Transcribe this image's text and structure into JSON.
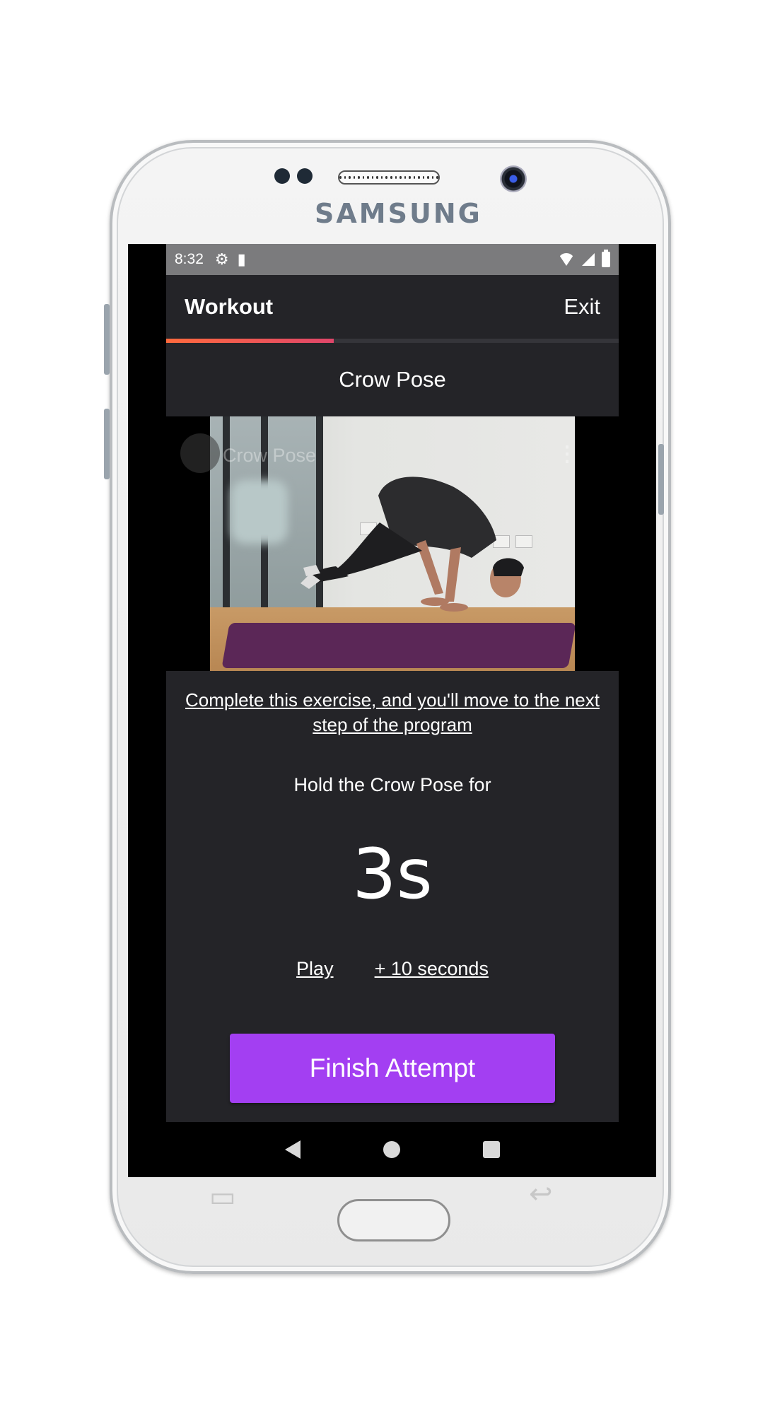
{
  "device": {
    "brand": "SAMSUNG"
  },
  "status_bar": {
    "time": "8:32",
    "icons_left": [
      "gear-icon",
      "sd-card-icon"
    ],
    "icons_right": [
      "wifi-icon",
      "signal-icon",
      "battery-icon"
    ]
  },
  "app_bar": {
    "title": "Workout",
    "exit_label": "Exit"
  },
  "progress": {
    "fraction": 0.37,
    "gradient": [
      "#ff6a3d",
      "#e0466a"
    ]
  },
  "exercise": {
    "name": "Crow Pose"
  },
  "video": {
    "overlay_title": "Crow Pose"
  },
  "main": {
    "hint": "Complete this exercise, and you'll move to the next step of the program",
    "hold_label": "Hold the Crow Pose for",
    "timer_value": "3s",
    "play_label": "Play",
    "add_time_label": "+ 10 seconds",
    "finish_label": "Finish Attempt"
  },
  "colors": {
    "app_background": "#242428",
    "accent_button": "#a33ff2",
    "status_bar": "#7b7b7d"
  }
}
